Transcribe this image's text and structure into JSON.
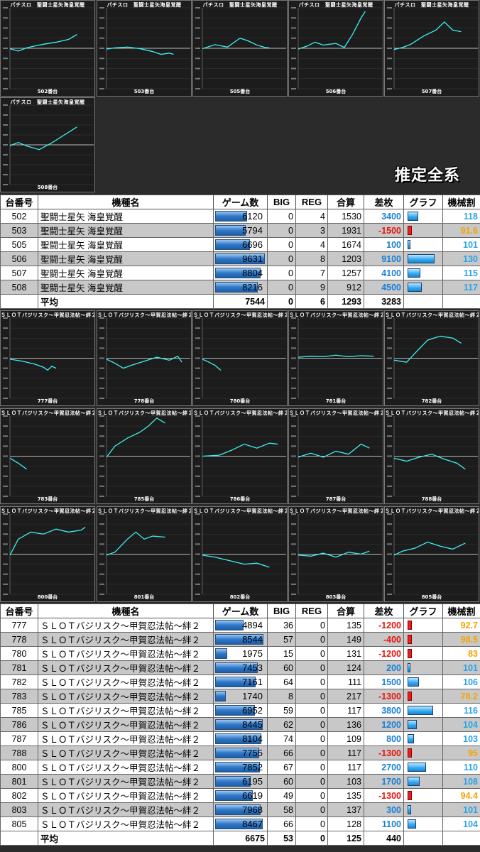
{
  "badge": "推定全系",
  "headers": [
    "台番号",
    "機種名",
    "ゲーム数",
    "BIG",
    "REG",
    "合算",
    "差枚",
    "グラフ",
    "機械割"
  ],
  "avg_label": "平均",
  "group1": {
    "panel_title": "パチスロ　聖闘士星矢海皇覚醒",
    "panels": [
      {
        "label": "502番台",
        "points": [
          [
            0,
            -100
          ],
          [
            10,
            -700
          ],
          [
            20,
            100
          ],
          [
            30,
            600
          ],
          [
            40,
            1000
          ],
          [
            55,
            1500
          ],
          [
            70,
            2200
          ],
          [
            80,
            3400
          ]
        ]
      },
      {
        "label": "503番台",
        "points": [
          [
            0,
            -200
          ],
          [
            10,
            100
          ],
          [
            25,
            300
          ],
          [
            40,
            -100
          ],
          [
            55,
            -800
          ],
          [
            65,
            -1500
          ],
          [
            75,
            -1200
          ],
          [
            80,
            -1500
          ]
        ]
      },
      {
        "label": "505番台",
        "points": [
          [
            0,
            -100
          ],
          [
            15,
            900
          ],
          [
            30,
            300
          ],
          [
            45,
            2500
          ],
          [
            55,
            1800
          ],
          [
            65,
            800
          ],
          [
            75,
            200
          ],
          [
            80,
            100
          ]
        ]
      },
      {
        "label": "506番台",
        "points": [
          [
            0,
            -200
          ],
          [
            10,
            500
          ],
          [
            20,
            1500
          ],
          [
            30,
            800
          ],
          [
            45,
            1200
          ],
          [
            55,
            200
          ],
          [
            65,
            3500
          ],
          [
            75,
            7500
          ],
          [
            80,
            9100
          ]
        ]
      },
      {
        "label": "507番台",
        "points": [
          [
            0,
            -300
          ],
          [
            10,
            200
          ],
          [
            20,
            1000
          ],
          [
            35,
            3000
          ],
          [
            50,
            4500
          ],
          [
            60,
            6500
          ],
          [
            70,
            4500
          ],
          [
            80,
            4100
          ]
        ]
      },
      {
        "label": "508番台",
        "points": [
          [
            0,
            -200
          ],
          [
            10,
            600
          ],
          [
            20,
            -300
          ],
          [
            35,
            -1200
          ],
          [
            50,
            500
          ],
          [
            65,
            2500
          ],
          [
            80,
            4500
          ]
        ]
      }
    ],
    "rows": [
      {
        "no": "502",
        "name": "聖闘士星矢 海皇覚醒",
        "games": "6120",
        "games_val": 6120,
        "big": "0",
        "reg": "4",
        "total": "1530",
        "diff": "3400",
        "diff_val": 3400,
        "rate": "118",
        "rate_color": "blue"
      },
      {
        "no": "503",
        "name": "聖闘士星矢 海皇覚醒",
        "games": "5794",
        "games_val": 5794,
        "big": "0",
        "reg": "3",
        "total": "1931",
        "diff": "-1500",
        "diff_val": -1500,
        "rate": "91.6",
        "rate_color": "orange"
      },
      {
        "no": "505",
        "name": "聖闘士星矢 海皇覚醒",
        "games": "6696",
        "games_val": 6696,
        "big": "0",
        "reg": "4",
        "total": "1674",
        "diff": "100",
        "diff_val": 100,
        "rate": "101",
        "rate_color": "blue"
      },
      {
        "no": "506",
        "name": "聖闘士星矢 海皇覚醒",
        "games": "9631",
        "games_val": 9631,
        "big": "0",
        "reg": "8",
        "total": "1203",
        "diff": "9100",
        "diff_val": 9100,
        "rate": "130",
        "rate_color": "blue"
      },
      {
        "no": "507",
        "name": "聖闘士星矢 海皇覚醒",
        "games": "8804",
        "games_val": 8804,
        "big": "0",
        "reg": "7",
        "total": "1257",
        "diff": "4100",
        "diff_val": 4100,
        "rate": "115",
        "rate_color": "blue"
      },
      {
        "no": "508",
        "name": "聖闘士星矢 海皇覚醒",
        "games": "8216",
        "games_val": 8216,
        "big": "0",
        "reg": "9",
        "total": "912",
        "diff": "4500",
        "diff_val": 4500,
        "rate": "117",
        "rate_color": "blue"
      }
    ],
    "avg": {
      "games": "7544",
      "big": "0",
      "reg": "6",
      "total": "1293",
      "diff": "3283"
    }
  },
  "group2": {
    "panel_title": "ＳＬＯＴバジリスク～甲賀忍法帖～絆２",
    "panels": [
      {
        "label": "777番台",
        "points": [
          [
            0,
            -100
          ],
          [
            15,
            -300
          ],
          [
            30,
            -600
          ],
          [
            40,
            -900
          ],
          [
            45,
            -1200
          ],
          [
            50,
            -800
          ],
          [
            55,
            -1000
          ]
        ]
      },
      {
        "label": "778番台",
        "points": [
          [
            0,
            -100
          ],
          [
            10,
            -500
          ],
          [
            20,
            -1000
          ],
          [
            30,
            -700
          ],
          [
            45,
            -300
          ],
          [
            60,
            100
          ],
          [
            75,
            -200
          ],
          [
            85,
            200
          ],
          [
            90,
            -400
          ]
        ]
      },
      {
        "label": "780番台",
        "points": [
          [
            0,
            -100
          ],
          [
            8,
            -400
          ],
          [
            15,
            -700
          ],
          [
            22,
            -1200
          ]
        ]
      },
      {
        "label": "781番台",
        "points": [
          [
            0,
            100
          ],
          [
            15,
            200
          ],
          [
            30,
            150
          ],
          [
            45,
            300
          ],
          [
            60,
            150
          ],
          [
            75,
            250
          ],
          [
            90,
            200
          ]
        ]
      },
      {
        "label": "782番台",
        "points": [
          [
            0,
            -200
          ],
          [
            15,
            -400
          ],
          [
            25,
            500
          ],
          [
            40,
            1800
          ],
          [
            55,
            2200
          ],
          [
            70,
            2000
          ],
          [
            80,
            1500
          ]
        ]
      },
      {
        "label": "783番台",
        "points": [
          [
            0,
            -200
          ],
          [
            10,
            -700
          ],
          [
            15,
            -1000
          ],
          [
            20,
            -1300
          ]
        ]
      },
      {
        "label": "785番台",
        "points": [
          [
            0,
            -100
          ],
          [
            10,
            1000
          ],
          [
            25,
            1800
          ],
          [
            40,
            2400
          ],
          [
            50,
            3000
          ],
          [
            60,
            3800
          ],
          [
            70,
            3300
          ]
        ]
      },
      {
        "label": "786番台",
        "points": [
          [
            0,
            0
          ],
          [
            20,
            100
          ],
          [
            35,
            600
          ],
          [
            50,
            1200
          ],
          [
            65,
            800
          ],
          [
            80,
            1300
          ],
          [
            90,
            1200
          ]
        ]
      },
      {
        "label": "787番台",
        "points": [
          [
            0,
            -100
          ],
          [
            15,
            300
          ],
          [
            30,
            -100
          ],
          [
            45,
            500
          ],
          [
            60,
            200
          ],
          [
            75,
            1200
          ],
          [
            85,
            800
          ]
        ]
      },
      {
        "label": "788番台",
        "points": [
          [
            0,
            -200
          ],
          [
            15,
            -500
          ],
          [
            30,
            -100
          ],
          [
            45,
            200
          ],
          [
            60,
            -300
          ],
          [
            75,
            -700
          ],
          [
            85,
            -1300
          ]
        ]
      },
      {
        "label": "800番台",
        "points": [
          [
            0,
            -100
          ],
          [
            10,
            1500
          ],
          [
            25,
            2200
          ],
          [
            40,
            2000
          ],
          [
            55,
            2500
          ],
          [
            70,
            2200
          ],
          [
            85,
            2400
          ],
          [
            90,
            2700
          ]
        ]
      },
      {
        "label": "801番台",
        "points": [
          [
            0,
            -100
          ],
          [
            10,
            200
          ],
          [
            25,
            1500
          ],
          [
            35,
            2200
          ],
          [
            45,
            1500
          ],
          [
            55,
            1800
          ],
          [
            70,
            1700
          ]
        ]
      },
      {
        "label": "802番台",
        "points": [
          [
            0,
            -100
          ],
          [
            15,
            -300
          ],
          [
            35,
            -700
          ],
          [
            50,
            -1000
          ],
          [
            65,
            -900
          ],
          [
            80,
            -1300
          ]
        ]
      },
      {
        "label": "803番台",
        "points": [
          [
            0,
            -100
          ],
          [
            15,
            -200
          ],
          [
            30,
            100
          ],
          [
            45,
            -300
          ],
          [
            60,
            200
          ],
          [
            75,
            0
          ],
          [
            85,
            300
          ]
        ]
      },
      {
        "label": "805番台",
        "points": [
          [
            0,
            -100
          ],
          [
            10,
            300
          ],
          [
            25,
            600
          ],
          [
            40,
            1200
          ],
          [
            55,
            800
          ],
          [
            70,
            500
          ],
          [
            85,
            1100
          ]
        ]
      }
    ],
    "rows": [
      {
        "no": "777",
        "name": "ＳＬＯＴバジリスク～甲賀忍法帖～絆２",
        "games": "4894",
        "games_val": 4894,
        "big": "36",
        "reg": "0",
        "total": "135",
        "diff": "-1200",
        "diff_val": -1200,
        "rate": "92.7",
        "rate_color": "orange"
      },
      {
        "no": "778",
        "name": "ＳＬＯＴバジリスク～甲賀忍法帖～絆２",
        "games": "8544",
        "games_val": 8544,
        "big": "57",
        "reg": "0",
        "total": "149",
        "diff": "-400",
        "diff_val": -400,
        "rate": "98.5",
        "rate_color": "orange"
      },
      {
        "no": "780",
        "name": "ＳＬＯＴバジリスク～甲賀忍法帖～絆２",
        "games": "1975",
        "games_val": 1975,
        "big": "15",
        "reg": "0",
        "total": "131",
        "diff": "-1200",
        "diff_val": -1200,
        "rate": "83",
        "rate_color": "orange"
      },
      {
        "no": "781",
        "name": "ＳＬＯＴバジリスク～甲賀忍法帖～絆２",
        "games": "7453",
        "games_val": 7453,
        "big": "60",
        "reg": "0",
        "total": "124",
        "diff": "200",
        "diff_val": 200,
        "rate": "101",
        "rate_color": "blue"
      },
      {
        "no": "782",
        "name": "ＳＬＯＴバジリスク～甲賀忍法帖～絆２",
        "games": "7161",
        "games_val": 7161,
        "big": "64",
        "reg": "0",
        "total": "111",
        "diff": "1500",
        "diff_val": 1500,
        "rate": "106",
        "rate_color": "blue"
      },
      {
        "no": "783",
        "name": "ＳＬＯＴバジリスク～甲賀忍法帖～絆２",
        "games": "1740",
        "games_val": 1740,
        "big": "8",
        "reg": "0",
        "total": "217",
        "diff": "-1300",
        "diff_val": -1300,
        "rate": "78.2",
        "rate_color": "orange"
      },
      {
        "no": "785",
        "name": "ＳＬＯＴバジリスク～甲賀忍法帖～絆２",
        "games": "6952",
        "games_val": 6952,
        "big": "59",
        "reg": "0",
        "total": "117",
        "diff": "3800",
        "diff_val": 3800,
        "rate": "116",
        "rate_color": "blue"
      },
      {
        "no": "786",
        "name": "ＳＬＯＴバジリスク～甲賀忍法帖～絆２",
        "games": "8445",
        "games_val": 8445,
        "big": "62",
        "reg": "0",
        "total": "136",
        "diff": "1200",
        "diff_val": 1200,
        "rate": "104",
        "rate_color": "blue"
      },
      {
        "no": "787",
        "name": "ＳＬＯＴバジリスク～甲賀忍法帖～絆２",
        "games": "8104",
        "games_val": 8104,
        "big": "74",
        "reg": "0",
        "total": "109",
        "diff": "800",
        "diff_val": 800,
        "rate": "103",
        "rate_color": "blue"
      },
      {
        "no": "788",
        "name": "ＳＬＯＴバジリスク～甲賀忍法帖～絆２",
        "games": "7755",
        "games_val": 7755,
        "big": "66",
        "reg": "0",
        "total": "117",
        "diff": "-1300",
        "diff_val": -1300,
        "rate": "95",
        "rate_color": "orange"
      },
      {
        "no": "800",
        "name": "ＳＬＯＴバジリスク～甲賀忍法帖～絆２",
        "games": "7852",
        "games_val": 7852,
        "big": "67",
        "reg": "0",
        "total": "117",
        "diff": "2700",
        "diff_val": 2700,
        "rate": "110",
        "rate_color": "blue"
      },
      {
        "no": "801",
        "name": "ＳＬＯＴバジリスク～甲賀忍法帖～絆２",
        "games": "6195",
        "games_val": 6195,
        "big": "60",
        "reg": "0",
        "total": "103",
        "diff": "1700",
        "diff_val": 1700,
        "rate": "108",
        "rate_color": "blue"
      },
      {
        "no": "802",
        "name": "ＳＬＯＴバジリスク～甲賀忍法帖～絆２",
        "games": "6619",
        "games_val": 6619,
        "big": "49",
        "reg": "0",
        "total": "135",
        "diff": "-1300",
        "diff_val": -1300,
        "rate": "94.4",
        "rate_color": "orange"
      },
      {
        "no": "803",
        "name": "ＳＬＯＴバジリスク～甲賀忍法帖～絆２",
        "games": "7968",
        "games_val": 7968,
        "big": "58",
        "reg": "0",
        "total": "137",
        "diff": "300",
        "diff_val": 300,
        "rate": "101",
        "rate_color": "blue"
      },
      {
        "no": "805",
        "name": "ＳＬＯＴバジリスク～甲賀忍法帖～絆２",
        "games": "8467",
        "games_val": 8467,
        "big": "66",
        "reg": "0",
        "total": "128",
        "diff": "1100",
        "diff_val": 1100,
        "rate": "104",
        "rate_color": "blue"
      }
    ],
    "avg": {
      "games": "6675",
      "big": "53",
      "reg": "0",
      "total": "125",
      "diff": "440"
    }
  }
}
